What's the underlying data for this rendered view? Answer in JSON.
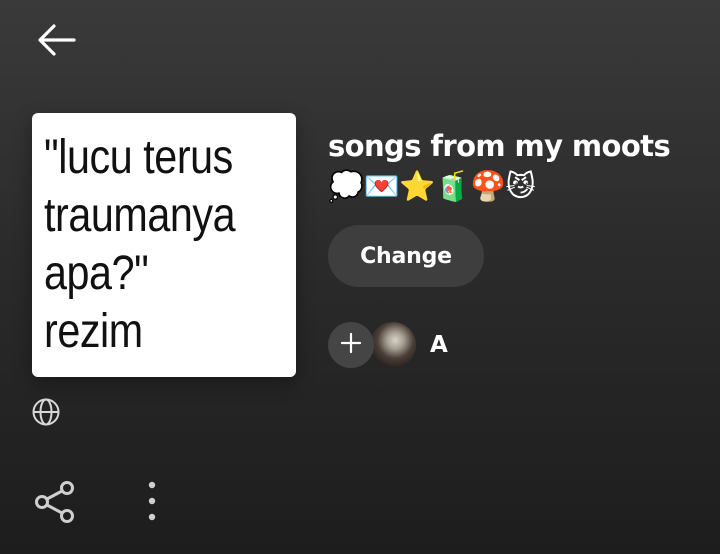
{
  "header": {
    "back_icon": "arrow-left-icon"
  },
  "playlist": {
    "cover_text": "\"lucu  terus\ntraumanya\napa?\"\nrezim",
    "title": "songs from my moots 💭💌⭐🧃🍄😼",
    "change_label": "Change",
    "owner_name": "A",
    "visibility_icon": "globe-icon"
  },
  "actions": {
    "add_icon": "plus-icon",
    "share_icon": "share-icon",
    "more_icon": "more-vertical-icon"
  },
  "colors": {
    "background_top": "#3a3a3a",
    "background_bottom": "#1d1d1d",
    "button_bg": "#3e3e3e",
    "text": "#ffffff"
  }
}
